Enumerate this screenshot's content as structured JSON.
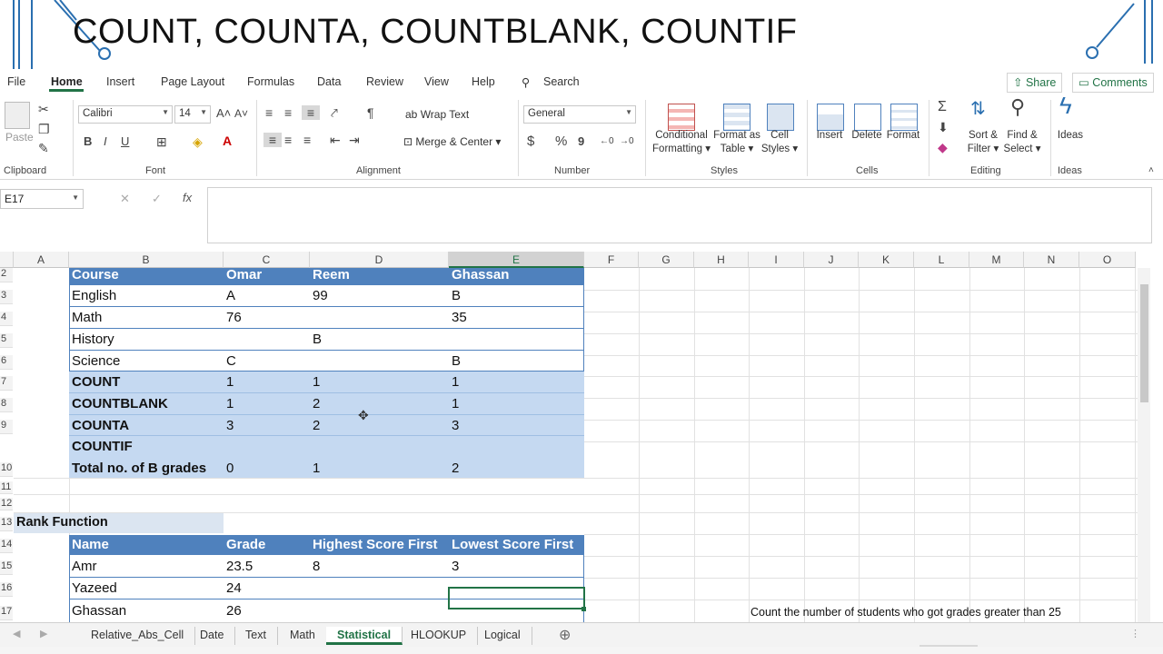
{
  "slide": {
    "title": "COUNT, COUNTA, COUNTBLANK, COUNTIF"
  },
  "ribbon": {
    "tabs": [
      "File",
      "Home",
      "Insert",
      "Page Layout",
      "Formulas",
      "Data",
      "Review",
      "View",
      "Help"
    ],
    "active_tab": "Home",
    "search_label": "Search",
    "share_label": "Share",
    "comments_label": "Comments",
    "clipboard": {
      "paste": "Paste",
      "group": "Clipboard"
    },
    "font": {
      "name": "Calibri",
      "size": "14",
      "group": "Font",
      "bold": "B",
      "italic": "I",
      "underline": "U"
    },
    "alignment": {
      "wrap_text": "Wrap Text",
      "merge_center": "Merge & Center",
      "group": "Alignment"
    },
    "number": {
      "format": "General",
      "currency": "$",
      "percent": "%",
      "comma": "9",
      "group": "Number"
    },
    "styles": {
      "conditional_formatting": [
        "Conditional",
        "Formatting"
      ],
      "format_as_table": [
        "Format as",
        "Table"
      ],
      "cell_styles": [
        "Cell",
        "Styles"
      ],
      "group": "Styles"
    },
    "cells": {
      "insert": "Insert",
      "delete": "Delete",
      "format": "Format",
      "group": "Cells"
    },
    "editing": {
      "sort_filter": [
        "Sort &",
        "Filter"
      ],
      "find_select": [
        "Find &",
        "Select"
      ],
      "group": "Editing"
    },
    "ideas": {
      "label": "Ideas",
      "group": "Ideas"
    }
  },
  "formula_bar": {
    "name_box": "E17",
    "cancel": "✕",
    "enter": "✓",
    "fx": "fx",
    "content": ""
  },
  "grid": {
    "columns": [
      "A",
      "B",
      "C",
      "D",
      "E",
      "F",
      "G",
      "H",
      "I",
      "J",
      "K",
      "L",
      "M",
      "N",
      "O"
    ],
    "selected_column": "E",
    "rows": [
      "2",
      "3",
      "4",
      "5",
      "6",
      "7",
      "8",
      "9",
      "10",
      "11",
      "12",
      "13",
      "14",
      "15",
      "16",
      "17"
    ],
    "table1": {
      "headers": [
        "Course",
        "Omar",
        "Reem",
        "Ghassan"
      ],
      "rows": [
        [
          "English",
          "A",
          "99",
          "B"
        ],
        [
          "Math",
          "76",
          "",
          "35"
        ],
        [
          "History",
          "",
          "B",
          ""
        ],
        [
          "Science",
          "C",
          "",
          "B"
        ]
      ],
      "summary": [
        [
          "COUNT",
          "1",
          "1",
          "1"
        ],
        [
          "COUNTBLANK",
          "1",
          "2",
          "1"
        ],
        [
          "COUNTA",
          "3",
          "2",
          "3"
        ]
      ],
      "countif_label_1": "COUNTIF",
      "countif_label_2": "Total no. of B grades",
      "countif_values": [
        "0",
        "1",
        "2"
      ]
    },
    "rank_title": "Rank Function",
    "table2": {
      "headers": [
        "Name",
        "Grade",
        "Highest Score First",
        "Lowest Score First"
      ],
      "rows": [
        [
          "Amr",
          "23.5",
          "8",
          "3"
        ],
        [
          "Yazeed",
          "24",
          "",
          ""
        ],
        [
          "Ghassan",
          "26",
          "",
          ""
        ]
      ]
    },
    "note": "Count the number of students who got grades greater than 25"
  },
  "sheet_tabs": {
    "tabs": [
      "Relative_Abs_Cell",
      "Date",
      "Text",
      "Math",
      "Statistical",
      "HLOOKUP",
      "Logical"
    ],
    "active": "Statistical"
  },
  "colors": {
    "header_blue": "#4f81bd",
    "band_blue": "#c5d9f1",
    "excel_green": "#217346"
  }
}
